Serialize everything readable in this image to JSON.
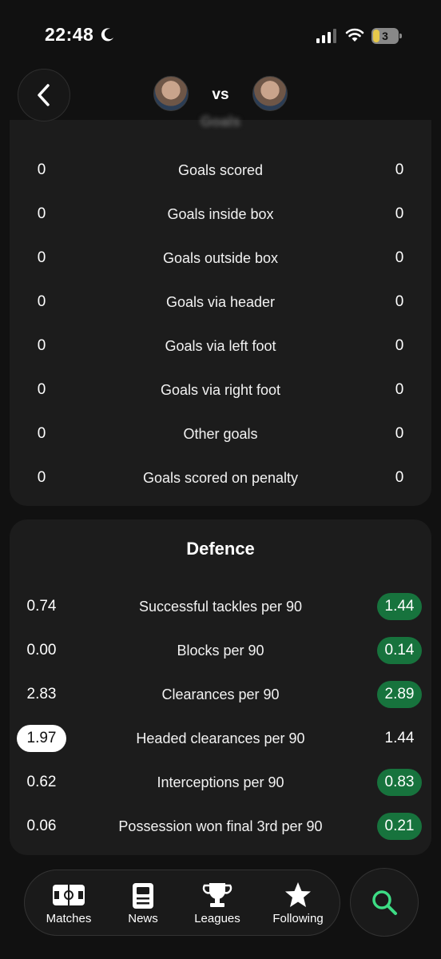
{
  "status": {
    "time": "22:48",
    "battery": "3"
  },
  "header": {
    "vs": "vs",
    "back_icon": "chevron-left-icon"
  },
  "goals": {
    "title": "Goals",
    "rows": [
      {
        "left": "0",
        "label": "Goals scored",
        "right": "0"
      },
      {
        "left": "0",
        "label": "Goals inside box",
        "right": "0"
      },
      {
        "left": "0",
        "label": "Goals outside box",
        "right": "0"
      },
      {
        "left": "0",
        "label": "Goals via header",
        "right": "0"
      },
      {
        "left": "0",
        "label": "Goals via left foot",
        "right": "0"
      },
      {
        "left": "0",
        "label": "Goals via right foot",
        "right": "0"
      },
      {
        "left": "0",
        "label": "Other goals",
        "right": "0"
      },
      {
        "left": "0",
        "label": "Goals scored on penalty",
        "right": "0"
      }
    ]
  },
  "defence": {
    "title": "Defence",
    "rows": [
      {
        "left": "0.74",
        "label": "Successful tackles per 90",
        "right": "1.44",
        "highlight": "right"
      },
      {
        "left": "0.00",
        "label": "Blocks per 90",
        "right": "0.14",
        "highlight": "right"
      },
      {
        "left": "2.83",
        "label": "Clearances per 90",
        "right": "2.89",
        "highlight": "right"
      },
      {
        "left": "1.97",
        "label": "Headed clearances per 90",
        "right": "1.44",
        "highlight": "left"
      },
      {
        "left": "0.62",
        "label": "Interceptions per 90",
        "right": "0.83",
        "highlight": "right"
      },
      {
        "left": "0.06",
        "label": "Possession won final 3rd per 90",
        "right": "0.21",
        "highlight": "right"
      }
    ]
  },
  "nav": {
    "items": [
      {
        "label": "Matches",
        "icon": "pitch-icon"
      },
      {
        "label": "News",
        "icon": "news-icon"
      },
      {
        "label": "Leagues",
        "icon": "trophy-icon"
      },
      {
        "label": "Following",
        "icon": "star-icon"
      }
    ],
    "search_icon": "search-icon"
  },
  "colors": {
    "background": "#111111",
    "card": "#1c1c1c",
    "highlight_green": "#17733d",
    "search_green": "#3ddc84"
  }
}
